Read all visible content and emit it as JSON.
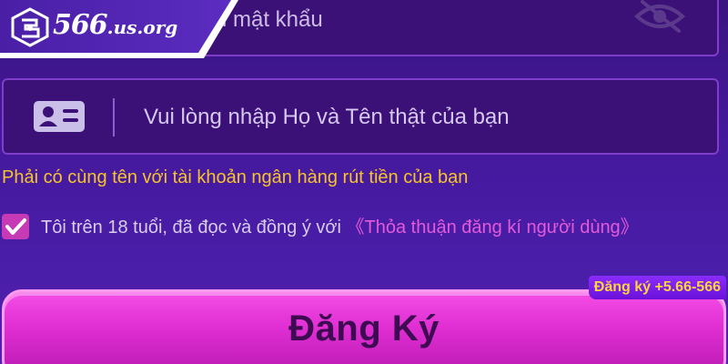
{
  "logo": {
    "number": "566",
    "domain": ".us.org",
    "icon": "566-logo-mark-icon"
  },
  "password_field": {
    "visible_placeholder": "i mật khẩu",
    "toggle_icon": "eye-off-icon"
  },
  "name_field": {
    "placeholder": "Vui lòng nhập Họ và Tên thật của bạn",
    "value": "",
    "icon": "id-card-icon"
  },
  "hint": "Phải có cùng tên với tài khoản ngân hàng rút tiền của bạn",
  "agreement": {
    "checked": true,
    "text": "Tôi trên 18 tuổi, đã đọc và đồng ý với ",
    "link_text": "《Thỏa thuận đăng kí người dùng》"
  },
  "register_button": {
    "label": "Đăng Ký"
  },
  "bonus_badge": "Đăng ký +5.66-566",
  "colors": {
    "background": "#43189a",
    "field_background": "#3b1178",
    "field_border": "#7e3ec9",
    "hint": "#f5c32c",
    "link": "#e45ad9",
    "button": "#e12fd4",
    "button_text": "#3e0b52",
    "badge_text": "#ffd43a"
  }
}
